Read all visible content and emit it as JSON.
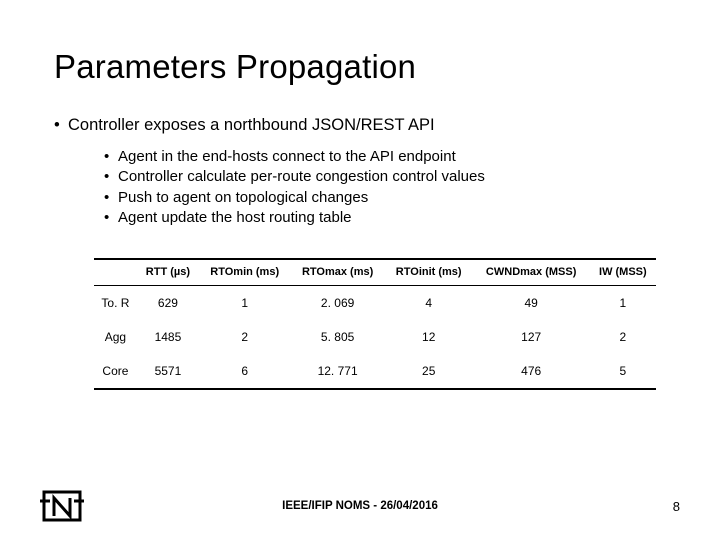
{
  "title": "Parameters Propagation",
  "bullet_main": "Controller exposes a northbound JSON/REST API",
  "sub_bullets": [
    "Agent in the end-hosts connect to the API endpoint",
    "Controller calculate per-route congestion control values",
    "Push to agent on topological changes",
    "Agent update the host routing table"
  ],
  "chart_data": {
    "type": "table",
    "headers": [
      "",
      "RTT (µs)",
      "RTOmin (ms)",
      "RTOmax (ms)",
      "RTOinit (ms)",
      "CWNDmax (MSS)",
      "IW (MSS)"
    ],
    "rows": [
      {
        "label": "To. R",
        "values": [
          "629",
          "1",
          "2. 069",
          "4",
          "49",
          "1"
        ]
      },
      {
        "label": "Agg",
        "values": [
          "1485",
          "2",
          "5. 805",
          "12",
          "127",
          "2"
        ]
      },
      {
        "label": "Core",
        "values": [
          "5571",
          "6",
          "12. 771",
          "25",
          "476",
          "5"
        ]
      }
    ]
  },
  "footer_text": "IEEE/IFIP NOMS - 26/04/2016",
  "page_number": "8"
}
